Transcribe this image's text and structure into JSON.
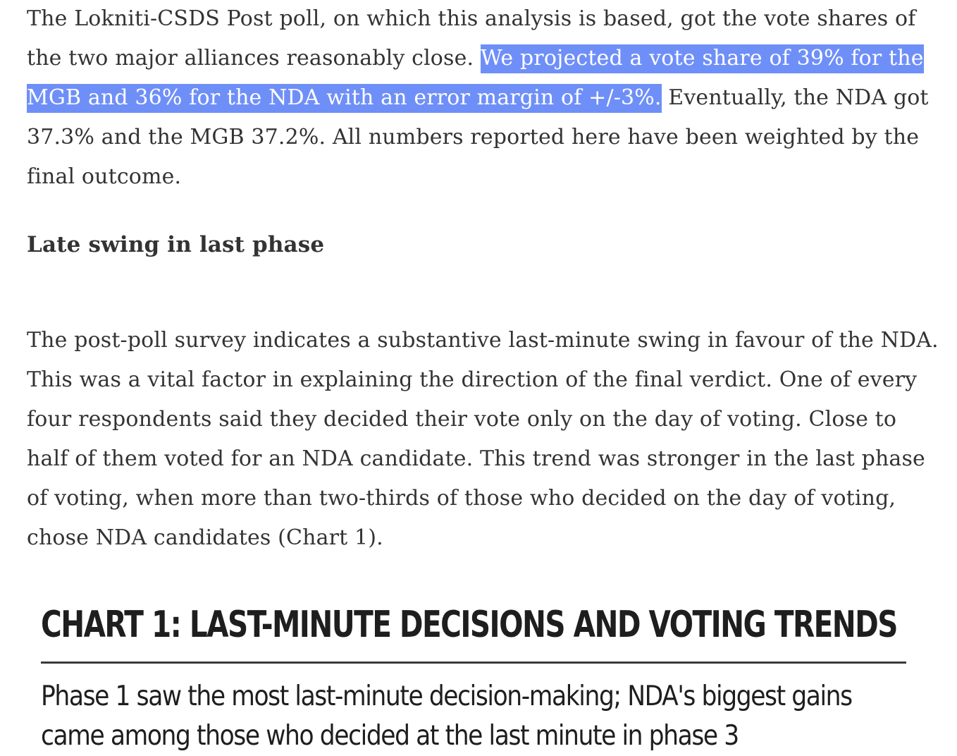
{
  "article": {
    "para1_before": "The Lokniti-CSDS Post poll, on which this analysis is based, got the vote shares of the two major alliances reasonably close. ",
    "para1_highlight": "We projected a vote share of 39% for the MGB and 36% for the NDA with an error margin of +/-3%.",
    "para1_after": " Eventually, the NDA got 37.3% and the MGB 37.2%. All numbers reported here have been weighted by the final outcome.",
    "heading": "Late swing in last phase",
    "para2": "The post-poll survey indicates a substantive last-minute swing in favour of the NDA. This was a vital factor in explaining the direction of the final verdict. One of every four respondents said they decided their vote only on the day of voting. Close to half of them voted for an NDA candidate. This trend was stronger in the last phase of voting, when more than two-thirds of those who decided on the day of voting, chose NDA candidates (Chart 1)."
  },
  "chart": {
    "title": "CHART 1: LAST-MINUTE DECISIONS AND VOTING TRENDS",
    "subtitle_line1": "Phase 1 saw the most last-minute decision-making; NDA's biggest gains",
    "subtitle_line2": "came among those who decided at the last minute in phase 3"
  },
  "colors": {
    "text": "#333333",
    "selection_highlight": "#6f8ff8",
    "chart_text": "#1e1e1e"
  }
}
